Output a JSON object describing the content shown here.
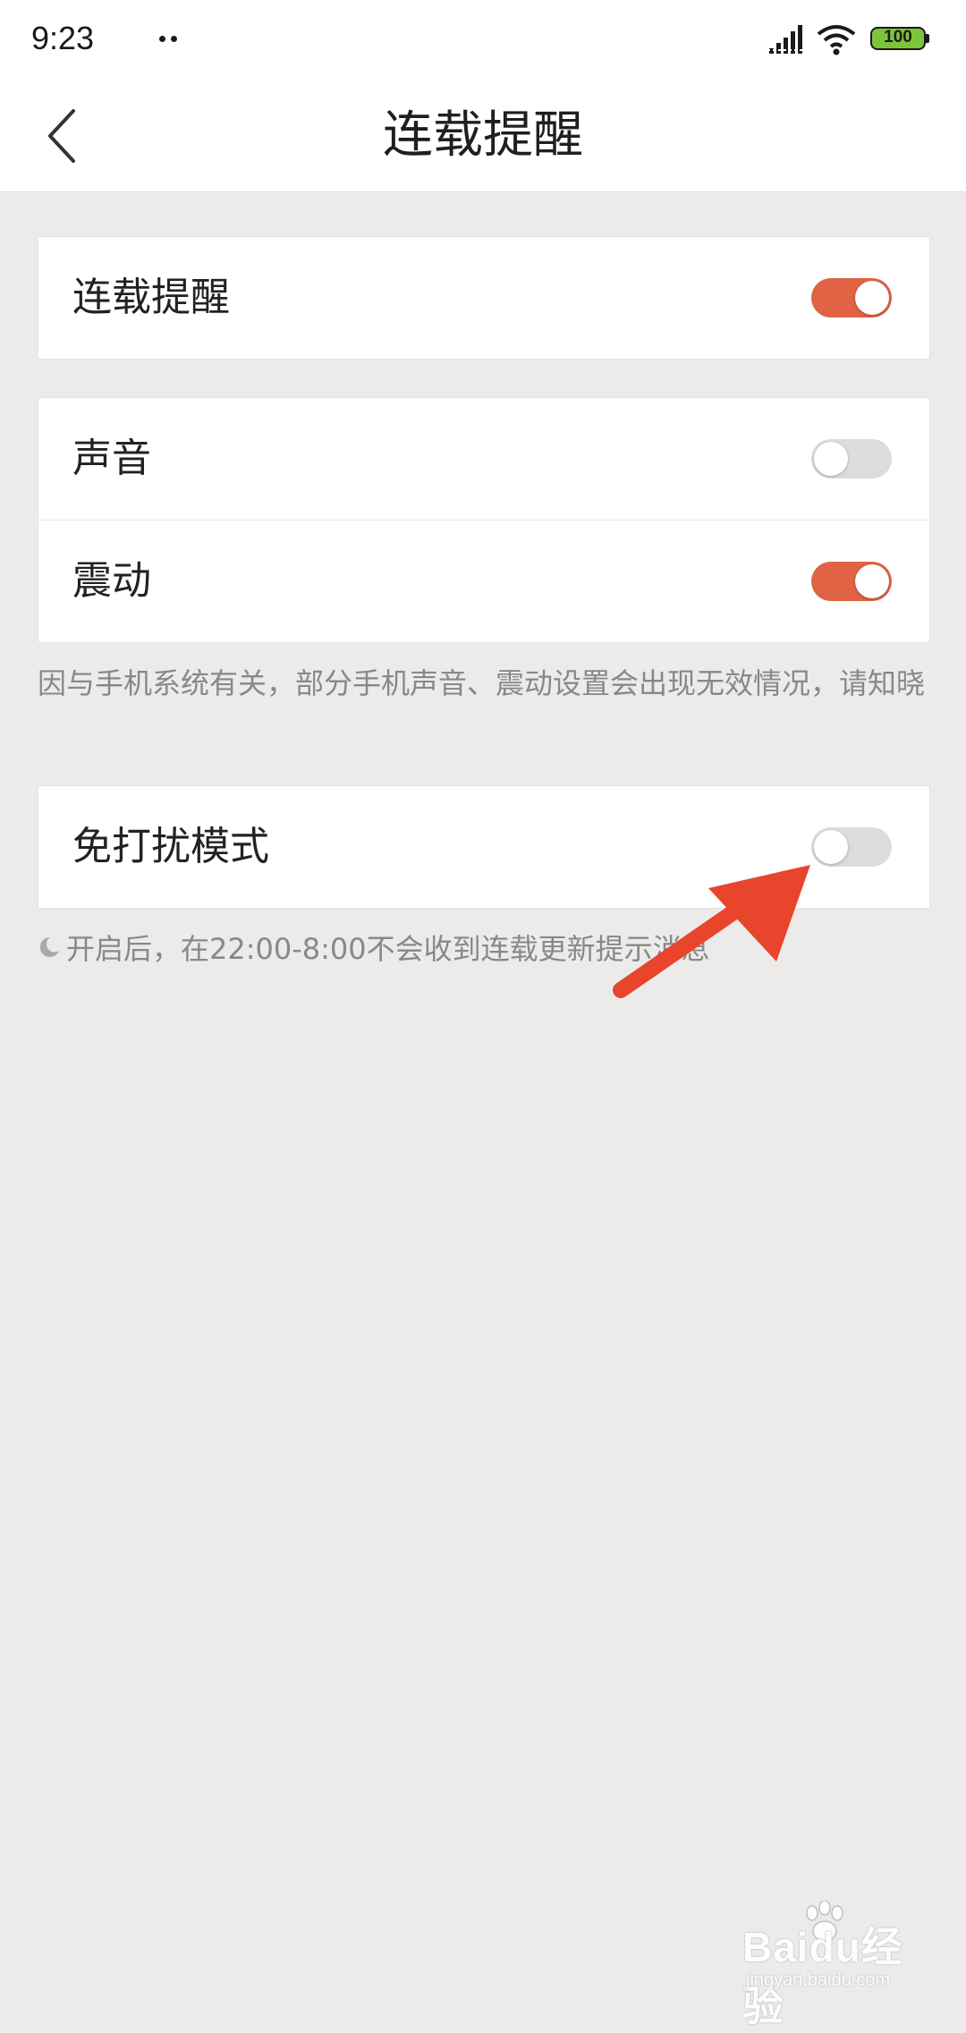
{
  "status_bar": {
    "time": "9:23",
    "battery": "100",
    "icons": [
      "signal-icon",
      "wifi-icon",
      "battery-icon"
    ]
  },
  "header": {
    "title": "连载提醒",
    "back_icon": "chevron-left-icon"
  },
  "sections": {
    "reminder": {
      "label": "连载提醒",
      "enabled": true
    },
    "sound": {
      "label": "声音",
      "enabled": false
    },
    "vibration": {
      "label": "震动",
      "enabled": true
    },
    "system_note": "因与手机系统有关，部分手机声音、震动设置会出现无效情况，请知晓",
    "dnd": {
      "label": "免打扰模式",
      "enabled": false
    },
    "dnd_note": "开启后，在22:00-8:00不会收到连载更新提示消息"
  },
  "colors": {
    "toggle_on": "#df6344",
    "toggle_off": "#dcdcdc",
    "background": "#ecebe9",
    "annotation_arrow": "#e8452c"
  },
  "watermark": {
    "brand": "Baidu经验",
    "site": "jingyan.baidu.com"
  }
}
